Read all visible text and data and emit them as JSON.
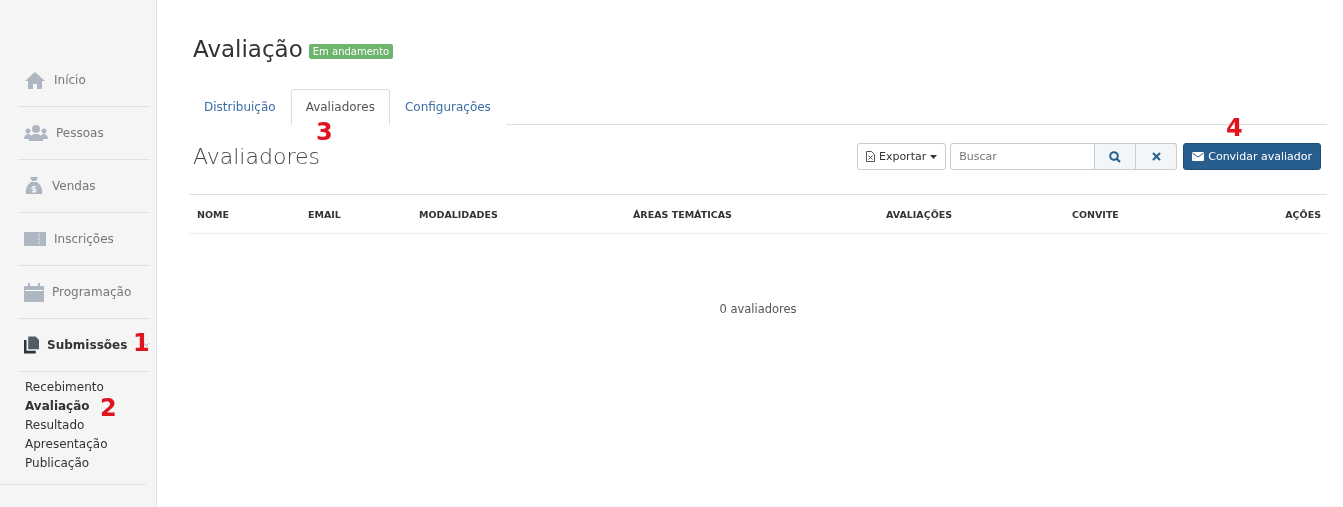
{
  "sidebar": {
    "items": [
      {
        "label": "Início",
        "selected": false
      },
      {
        "label": "Pessoas",
        "selected": false
      },
      {
        "label": "Vendas",
        "selected": false
      },
      {
        "label": "Inscrições",
        "selected": false
      },
      {
        "label": "Programação",
        "selected": false
      },
      {
        "label": "Submissões",
        "selected": true,
        "expanded": true,
        "children": [
          {
            "label": "Recebimento",
            "selected": false
          },
          {
            "label": "Avaliação",
            "selected": true
          },
          {
            "label": "Resultado",
            "selected": false
          },
          {
            "label": "Apresentação",
            "selected": false
          },
          {
            "label": "Publicação",
            "selected": false
          }
        ]
      }
    ]
  },
  "page": {
    "title": "Avaliação",
    "status": "Em andamento"
  },
  "tabs": [
    {
      "label": "Distribuição",
      "selected": false
    },
    {
      "label": "Avaliadores",
      "selected": true
    },
    {
      "label": "Configurações",
      "selected": false
    }
  ],
  "section": {
    "title": "Avaliadores",
    "export_button": "Exportar",
    "search": {
      "placeholder": "Buscar"
    },
    "invite_button": "Convidar avaliador"
  },
  "table": {
    "columns": [
      "NOME",
      "EMAIL",
      "MODALIDADES",
      "ÁREAS TEMÁTICAS",
      "AVALIAÇÕES",
      "CONVITE",
      "AÇÕES"
    ],
    "empty_message": "0 avaliadores"
  },
  "annotations": [
    {
      "label": "1"
    },
    {
      "label": "2"
    },
    {
      "label": "3"
    },
    {
      "label": "4"
    }
  ]
}
